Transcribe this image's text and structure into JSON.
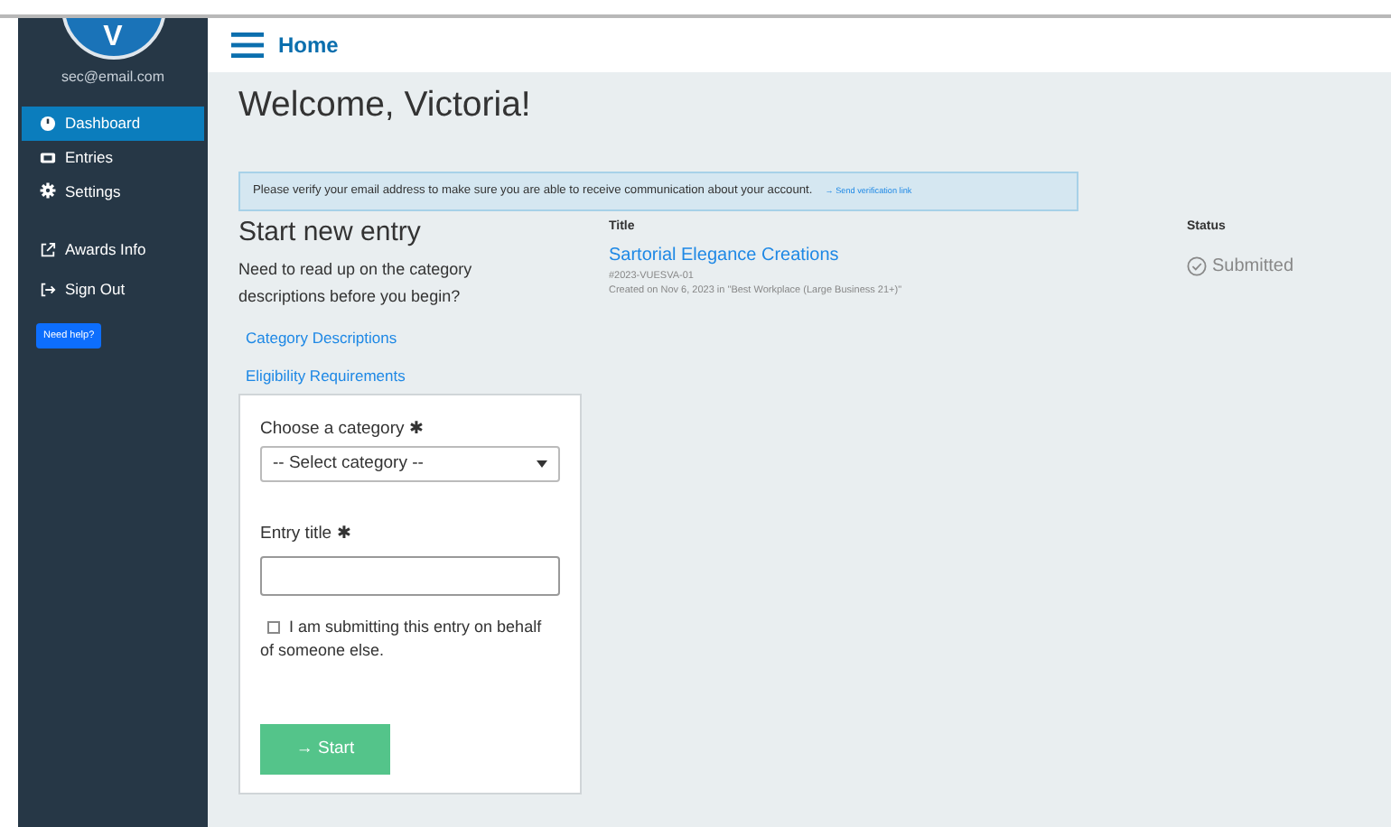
{
  "sidebar": {
    "avatar_letter": "V",
    "email": "sec@email.com",
    "items": [
      {
        "label": "Dashboard",
        "selected": true
      },
      {
        "label": "Entries",
        "selected": false
      },
      {
        "label": "Settings",
        "selected": false
      }
    ],
    "links": [
      {
        "label": "Awards Info"
      },
      {
        "label": "Sign Out"
      }
    ],
    "help_button": "Need help?"
  },
  "header": {
    "title": "Home"
  },
  "welcome": "Welcome, Victoria!",
  "alert": {
    "message": "Please verify your email address to make sure you are able to receive communication about your account.",
    "link": "→ Send verification link"
  },
  "start": {
    "heading": "Start new entry",
    "intro": "Need to read up on the category descriptions before you begin?",
    "links": [
      "Category Descriptions",
      "Eligibility Requirements"
    ],
    "form": {
      "category_label": "Choose a category",
      "category_required": "✱",
      "category_placeholder": "-- Select category --",
      "title_label": "Entry title",
      "title_required": "✱",
      "on_behalf_label": "I am submitting this entry on behalf of someone else.",
      "on_behalf_checked": false,
      "start_button": "→ Start"
    }
  },
  "entries": {
    "columns": [
      "Title",
      "Status"
    ],
    "rows": [
      {
        "title": "Sartorial Elegance Creations",
        "code": "#2023-VUESVA-01",
        "created": "Created on Nov 6, 2023 in \"Best Workplace (Large Business 21+)\"",
        "status": "Submitted"
      }
    ]
  }
}
